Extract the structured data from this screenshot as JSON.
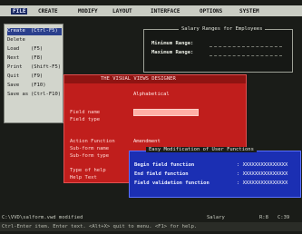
{
  "menubar": {
    "items": [
      "FILE",
      "CREATE",
      "MODIFY",
      "LAYOUT",
      "INTERFACE",
      "OPTIONS",
      "SYSTEM"
    ],
    "active_index": 0
  },
  "file_menu": {
    "items": [
      {
        "label": "Create",
        "accel": "(Ctrl-F5)"
      },
      {
        "label": "Delete",
        "accel": ""
      },
      {
        "label": "Load",
        "accel": "(F5)"
      },
      {
        "label": "Next",
        "accel": "(F8)"
      },
      {
        "label": "Print",
        "accel": "(Shift-F5)"
      },
      {
        "label": "Quit",
        "accel": "(F9)"
      },
      {
        "label": "Save",
        "accel": "(F10)"
      },
      {
        "label": "Save as",
        "accel": "(Ctrl-F10)"
      }
    ],
    "highlighted_index": 0
  },
  "range_panel": {
    "title": "Salary Ranges for Employees",
    "rows": [
      "Minimum Range:",
      "Maximum Range:"
    ]
  },
  "designer": {
    "title": "THE VISUAL VIEWS DESIGNER",
    "rows": [
      {
        "label": "",
        "value": "Alphabetical"
      },
      {
        "label": "Field name",
        "value": ""
      },
      {
        "label": "Field type",
        "value": ""
      },
      {
        "label": "Action Function",
        "value": "Amendment"
      },
      {
        "label": "Sub-form name",
        "value": ""
      },
      {
        "label": "Sub-form type",
        "value": ""
      },
      {
        "label": "Type of help",
        "value": ""
      },
      {
        "label": "Help Text",
        "value": ""
      }
    ]
  },
  "udf_dialog": {
    "title": "Easy Modification of User Functions",
    "rows": [
      {
        "label": "Begin field function",
        "value": ": XXXXXXXXXXXXXXX"
      },
      {
        "label": "End field function",
        "value": ": XXXXXXXXXXXXXXX"
      },
      {
        "label": "Field validation function",
        "value": ": XXXXXXXXXXXXXXX"
      }
    ]
  },
  "status": {
    "path": "C:\\VVD\\salform.vwd  modified",
    "field": "Salary",
    "pos": "R:8",
    "pos2": "C:39",
    "hint": "Ctrl-Enter item.  Enter text.  <Alt+X> quit to menu.  <F1> for help."
  },
  "colors": {
    "menubar_bg": "#c9ccc3",
    "designer_bg": "#c01e1c",
    "dialog_bg": "#1b2fb3",
    "menu_highlight": "#2a3f8c"
  }
}
